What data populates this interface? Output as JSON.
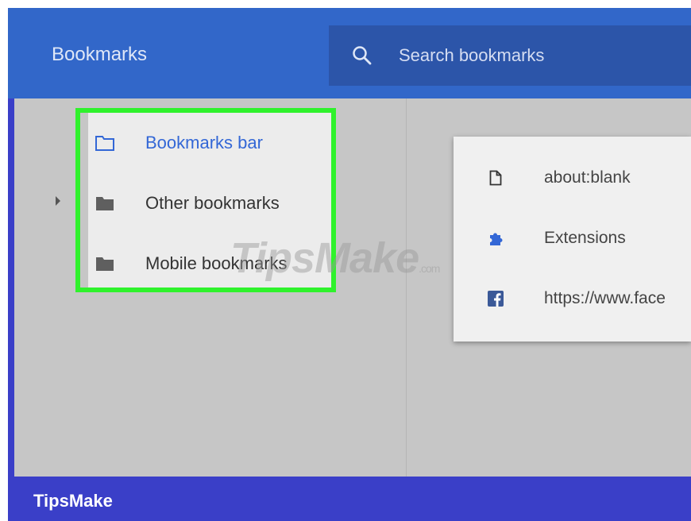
{
  "header": {
    "title": "Bookmarks",
    "search_placeholder": "Search bookmarks"
  },
  "tree": {
    "items": [
      {
        "label": "Bookmarks bar",
        "icon": "folder-outline-icon",
        "active": true
      },
      {
        "label": "Other bookmarks",
        "icon": "folder-icon",
        "active": false
      },
      {
        "label": "Mobile bookmarks",
        "icon": "folder-icon",
        "active": false
      }
    ]
  },
  "list": {
    "items": [
      {
        "label": "about:blank",
        "icon": "page-icon"
      },
      {
        "label": "Extensions",
        "icon": "puzzle-icon"
      },
      {
        "label": "https://www.face",
        "icon": "facebook-icon"
      }
    ]
  },
  "watermark": {
    "text": "TipsMake",
    "suffix": ".com"
  },
  "footer": {
    "brand": "TipsMake"
  },
  "colors": {
    "header": "#3267c9",
    "search": "#2c55a9",
    "highlight": "#2ff22c",
    "accent": "#3367d6",
    "footer": "#3a3fc8"
  }
}
